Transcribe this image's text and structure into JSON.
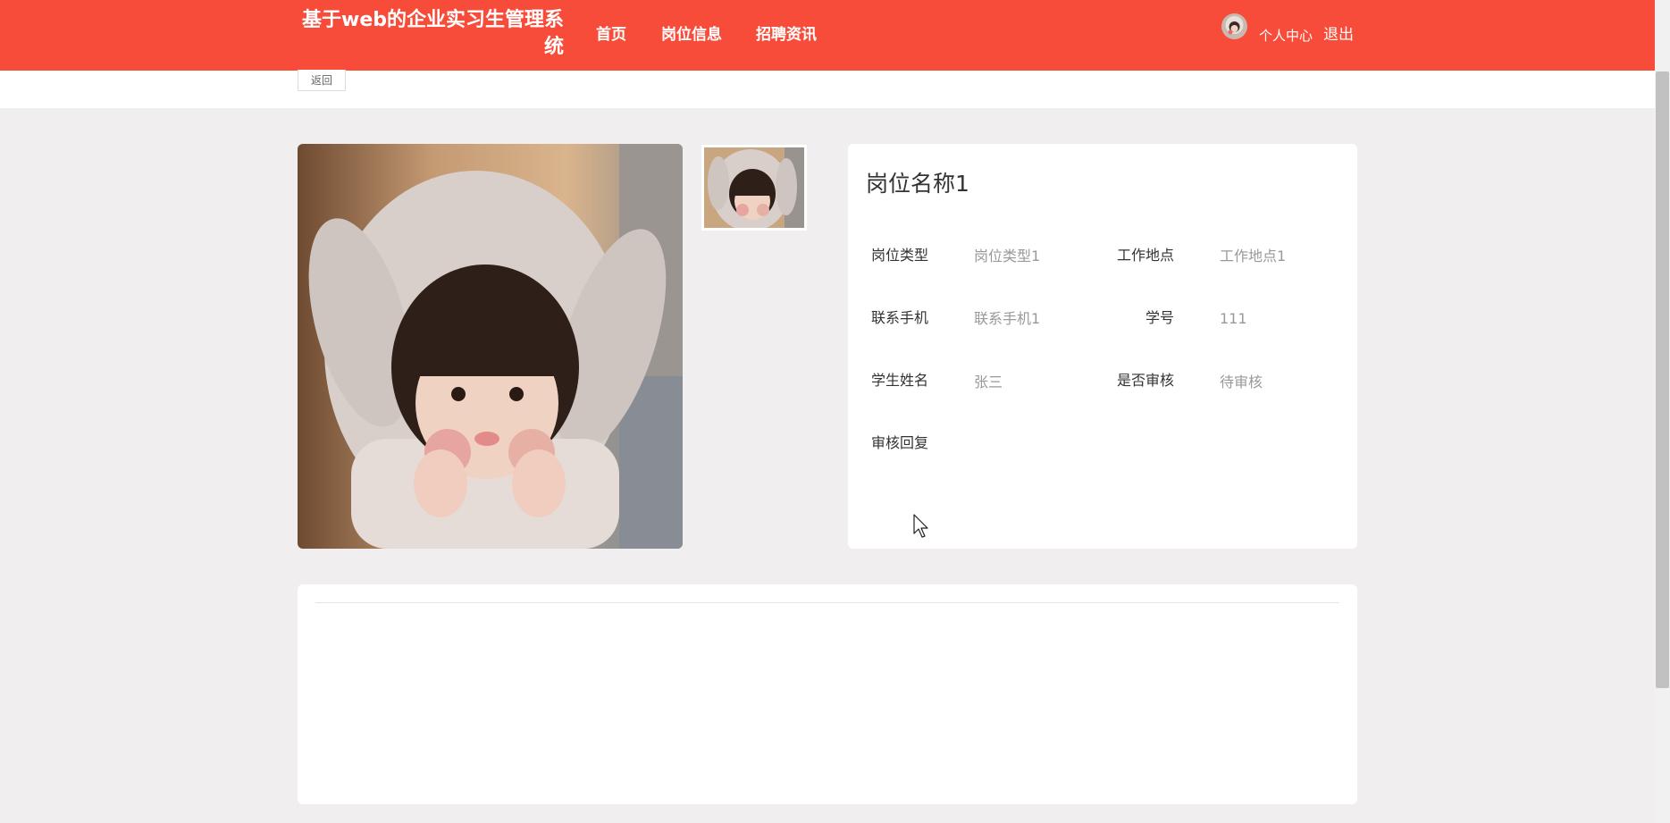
{
  "header": {
    "brand_title": "基于web的企业实习生管理系统",
    "nav": [
      {
        "label": "首页"
      },
      {
        "label": "岗位信息"
      },
      {
        "label": "招聘资讯"
      }
    ],
    "user_center": "个人中心",
    "logout": "退出",
    "bg_color": "#f84c3b"
  },
  "toolbar": {
    "back_label": "返回"
  },
  "detail": {
    "title": "岗位名称1",
    "fields": [
      {
        "label": "岗位类型",
        "value": "岗位类型1"
      },
      {
        "label": "工作地点",
        "value": "工作地点1"
      },
      {
        "label": "联系手机",
        "value": "联系手机1"
      },
      {
        "label": "学号",
        "value": "111"
      },
      {
        "label": "学生姓名",
        "value": "张三"
      },
      {
        "label": "是否审核",
        "value": "待审核"
      },
      {
        "label": "审核回复",
        "value": ""
      }
    ]
  },
  "icons": {
    "avatar": "user-avatar-icon",
    "cursor": "mouse-pointer-icon"
  }
}
